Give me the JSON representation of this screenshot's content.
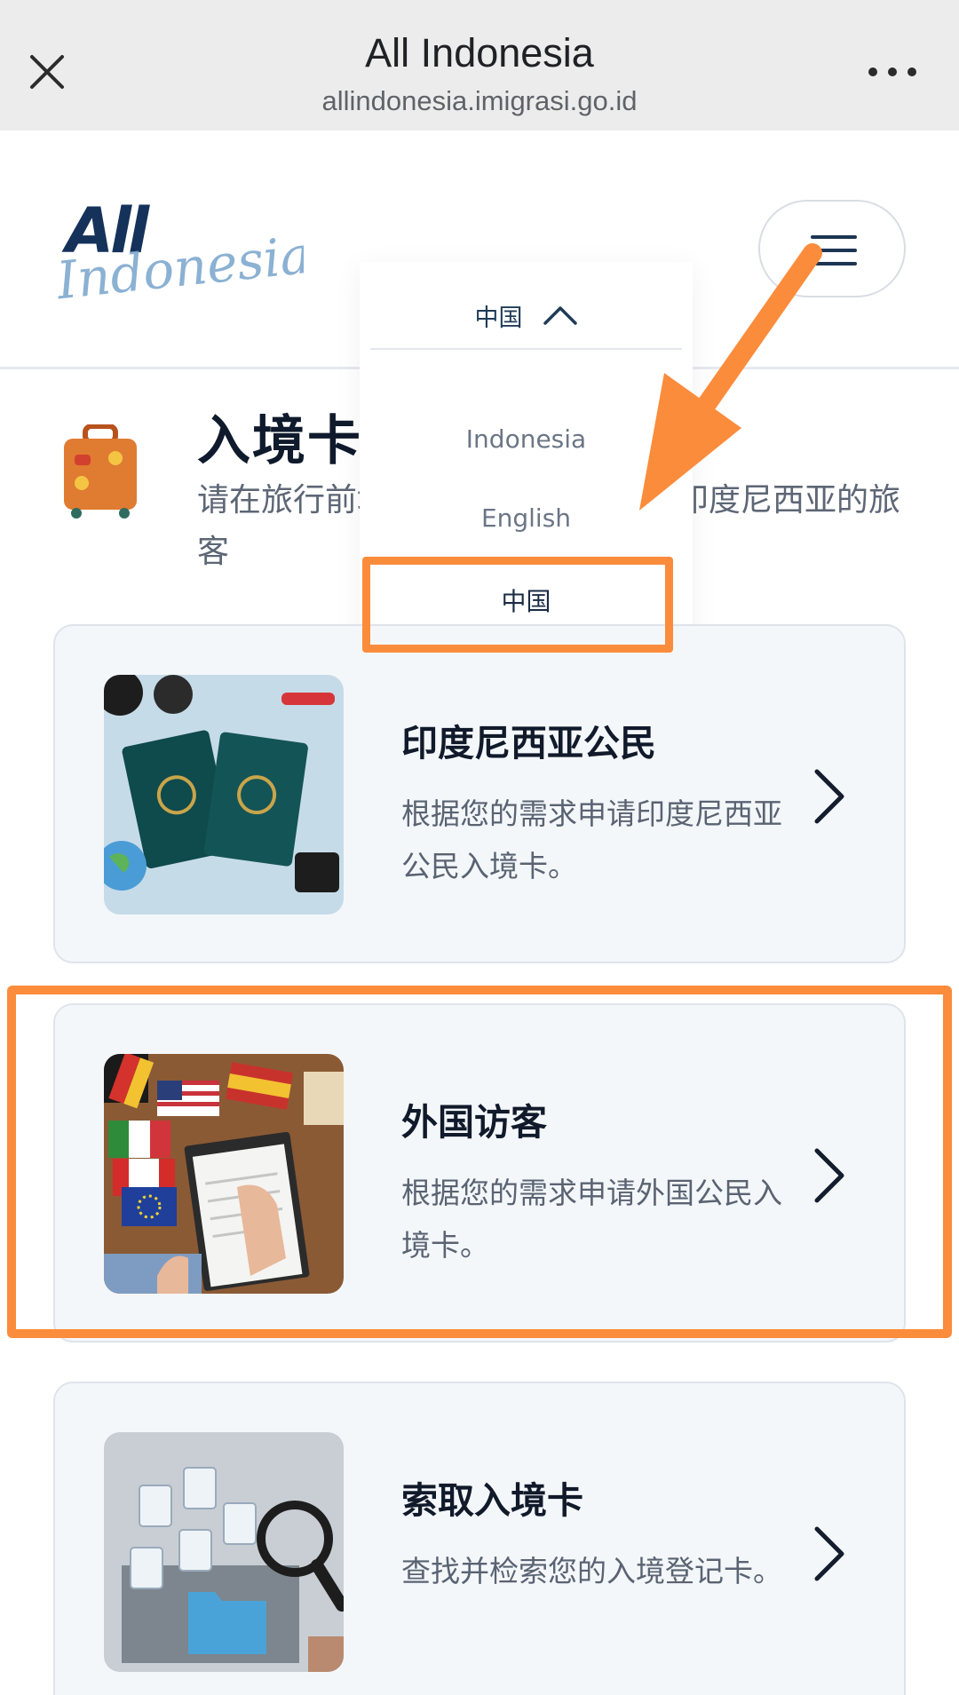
{
  "browser": {
    "title": "All Indonesia",
    "url": "allindonesia.imigrasi.go.id"
  },
  "site": {
    "logo_text_top": "All",
    "logo_text_script": "Indonesia"
  },
  "section": {
    "title": "入境卡",
    "description": "请在旅行前填写入境卡，所有入境印度尼西亚的旅客"
  },
  "language_dropdown": {
    "current": "中国",
    "options": [
      "Indonesia",
      "English",
      "中国"
    ],
    "selected_index": 2
  },
  "cards": [
    {
      "title": "印度尼西亚公民",
      "description": "根据您的需求申请印度尼西亚公民入境卡。"
    },
    {
      "title": "外国访客",
      "description": "根据您的需求申请外国公民入境卡。"
    },
    {
      "title": "索取入境卡",
      "description": "查找并检索您的入境登记卡。"
    }
  ],
  "colors": {
    "annotation": "#fb8c3c",
    "logo_navy": "#15325a",
    "logo_light": "#7fa9cf",
    "card_bg": "#f4f7fa"
  }
}
